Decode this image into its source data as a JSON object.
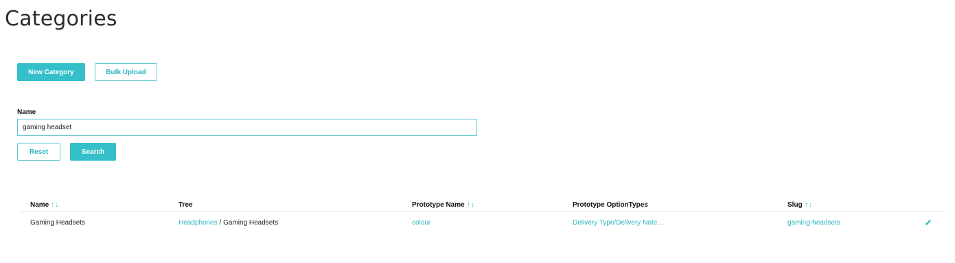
{
  "page": {
    "title": "Categories"
  },
  "actions": {
    "new_category_label": "New Category",
    "bulk_upload_label": "Bulk Upload"
  },
  "filter": {
    "name_label": "Name",
    "name_value": "gaming headset",
    "reset_label": "Reset",
    "search_label": "Search"
  },
  "table": {
    "sort_glyph": "↑↓",
    "headers": {
      "name": "Name",
      "tree": "Tree",
      "prototype_name": "Prototype Name",
      "prototype_option_types": "Prototype OptionTypes",
      "slug": "Slug"
    },
    "rows": [
      {
        "name": "Gaming Headsets",
        "tree_parent": "Headphones",
        "tree_separator": " / ",
        "tree_leaf": "Gaming Headsets",
        "prototype_name": "colour",
        "prototype_option_types": "Delivery Type/Delivery Note...",
        "slug": "gaming-headsets",
        "edit_icon": "pencil-icon"
      }
    ]
  },
  "colors": {
    "accent": "#34bfc9",
    "link": "#2cb5c0"
  }
}
